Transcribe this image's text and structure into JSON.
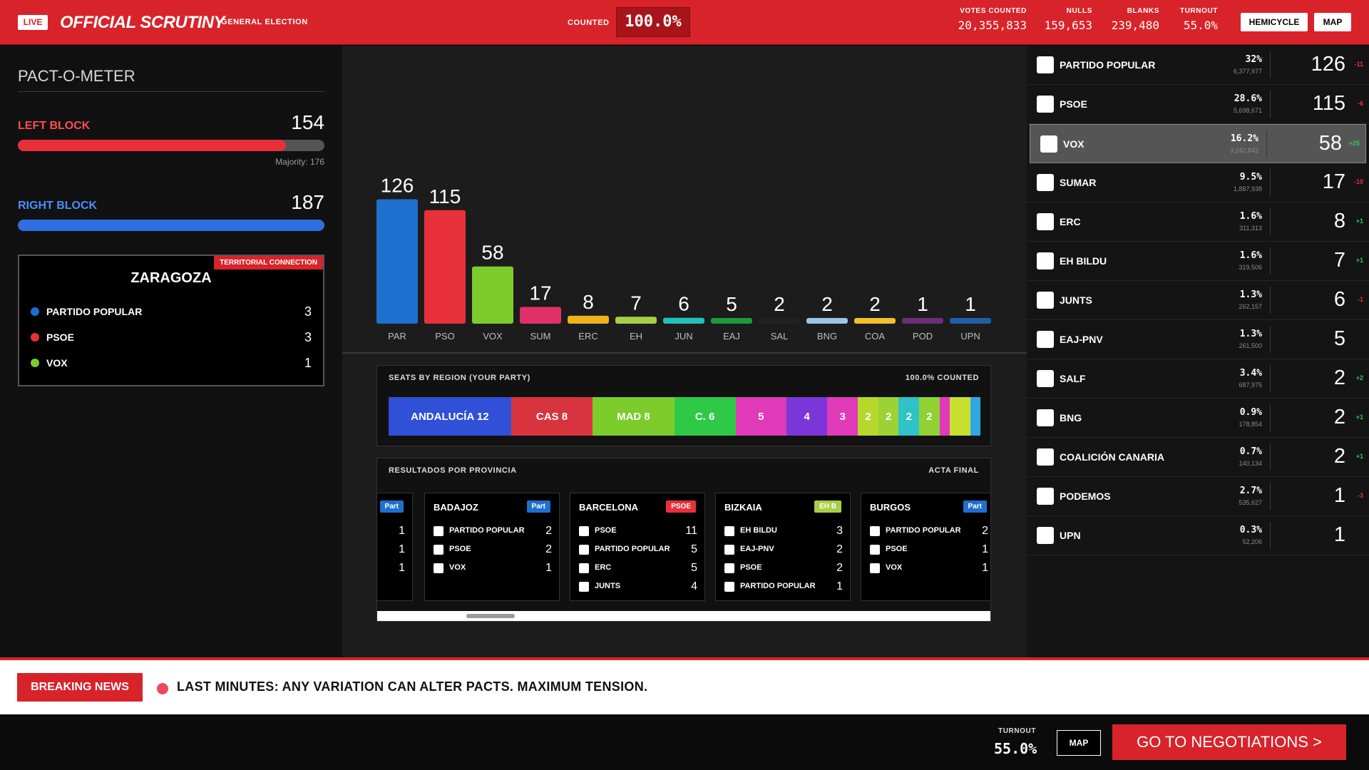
{
  "header": {
    "live": "LIVE",
    "brand": "OFFICIAL SCRUTINY",
    "subtitle": "GENERAL ELECTION",
    "counted_label": "COUNTED",
    "counted_value": "100.0%",
    "stats": [
      {
        "label": "VOTES COUNTED",
        "value": "20,355,833"
      },
      {
        "label": "NULLS",
        "value": "159,653"
      },
      {
        "label": "BLANKS",
        "value": "239,480"
      },
      {
        "label": "TURNOUT",
        "value": "55.0%"
      }
    ],
    "hemicycle_button": "HEMICYCLE",
    "map_button": "MAP"
  },
  "pact": {
    "title": "PACT-O-METER",
    "left": {
      "name": "LEFT BLOCK",
      "value": "154",
      "fill_fraction": 0.875,
      "color": "#e8303b"
    },
    "majority": "Majority: 176",
    "right": {
      "name": "RIGHT BLOCK",
      "value": "187",
      "fill_fraction": 1.0,
      "color": "#2f6ee0"
    },
    "territory": {
      "tag": "TERRITORIAL CONNECTION",
      "title": "ZARAGOZA",
      "rows": [
        {
          "name": "PARTIDO POPULAR",
          "value": "3",
          "color": "#1e6fd0"
        },
        {
          "name": "PSOE",
          "value": "3",
          "color": "#e8303b"
        },
        {
          "name": "VOX",
          "value": "1",
          "color": "#7ccc2c"
        }
      ]
    }
  },
  "chart_data": {
    "type": "bar",
    "categories": [
      "PAR",
      "PSO",
      "VOX",
      "SUM",
      "ERC",
      "EH",
      "JUN",
      "EAJ",
      "SAL",
      "BNG",
      "COA",
      "POD",
      "UPN"
    ],
    "values": [
      126,
      115,
      58,
      17,
      8,
      7,
      6,
      5,
      2,
      2,
      2,
      1,
      1
    ],
    "colors": [
      "#1f6fce",
      "#e8303b",
      "#7ccc2c",
      "#e0306a",
      "#f0b21a",
      "#a8cf45",
      "#22c0b8",
      "#1f9a3a",
      "#222222",
      "#9ec5e6",
      "#f2c02a",
      "#6b2f7a",
      "#1f5fa8"
    ],
    "ylim": [
      0,
      130
    ]
  },
  "regions": {
    "title": "SEATS BY REGION (YOUR PARTY)",
    "status": "100.0% COUNTED",
    "segments": [
      {
        "label": "ANDALUCÍA 12",
        "weight": 12,
        "color": "#3050d8"
      },
      {
        "label": "CAS 8",
        "weight": 8,
        "color": "#d8343e"
      },
      {
        "label": "MAD 8",
        "weight": 8,
        "color": "#7ccc2c"
      },
      {
        "label": "C. 6",
        "weight": 6,
        "color": "#2fc948"
      },
      {
        "label": "5",
        "weight": 5,
        "color": "#e03ab8"
      },
      {
        "label": "4",
        "weight": 4,
        "color": "#7a36d8"
      },
      {
        "label": "3",
        "weight": 3,
        "color": "#e03ab8"
      },
      {
        "label": "2",
        "weight": 2,
        "color": "#b5d82a"
      },
      {
        "label": "2",
        "weight": 2,
        "color": "#9ed234"
      },
      {
        "label": "2",
        "weight": 2,
        "color": "#2fc2c8"
      },
      {
        "label": "2",
        "weight": 2,
        "color": "#90d234"
      },
      {
        "label": "",
        "weight": 1,
        "color": "#e03ab8"
      },
      {
        "label": "",
        "weight": 2,
        "color": "#c8e030"
      },
      {
        "label": "",
        "weight": 1,
        "color": "#2fa8e0"
      }
    ]
  },
  "provinces": {
    "title": "RESULTADOS POR PROVINCIA",
    "status": "ACTA FINAL",
    "partial": {
      "tag": "Part",
      "values": [
        "1",
        "1",
        "1"
      ]
    },
    "cards": [
      {
        "name": "BADAJOZ",
        "tag": "Part",
        "tag_color": "#1f6fce",
        "rows": [
          {
            "name": "PARTIDO POPULAR",
            "value": "2"
          },
          {
            "name": "PSOE",
            "value": "2"
          },
          {
            "name": "VOX",
            "value": "1"
          }
        ]
      },
      {
        "name": "BARCELONA",
        "tag": "PSOE",
        "tag_color": "#e8303b",
        "rows": [
          {
            "name": "PSOE",
            "value": "11"
          },
          {
            "name": "PARTIDO POPULAR",
            "value": "5"
          },
          {
            "name": "ERC",
            "value": "5"
          },
          {
            "name": "JUNTS",
            "value": "4"
          }
        ]
      },
      {
        "name": "BIZKAIA",
        "tag": "EH B",
        "tag_color": "#a8cf45",
        "rows": [
          {
            "name": "EH BILDU",
            "value": "3"
          },
          {
            "name": "EAJ-PNV",
            "value": "2"
          },
          {
            "name": "PSOE",
            "value": "2"
          },
          {
            "name": "PARTIDO POPULAR",
            "value": "1"
          }
        ]
      },
      {
        "name": "BURGOS",
        "tag": "Part",
        "tag_color": "#1f6fce",
        "rows": [
          {
            "name": "PARTIDO POPULAR",
            "value": "2"
          },
          {
            "name": "PSOE",
            "value": "1"
          },
          {
            "name": "VOX",
            "value": "1"
          }
        ]
      }
    ]
  },
  "parties": [
    {
      "name": "PARTIDO POPULAR",
      "logo": "pp-logo-icon",
      "pct": "32%",
      "votes": "6,377,977",
      "seats": "126",
      "diff": "-11",
      "diff_color": "#e8303b",
      "highlight": false
    },
    {
      "name": "PSOE",
      "logo": "psoe-logo-icon",
      "pct": "28.6%",
      "votes": "5,698,671",
      "seats": "115",
      "diff": "-6",
      "diff_color": "#e8303b",
      "highlight": false
    },
    {
      "name": "VOX",
      "logo": "vox-logo-icon",
      "pct": "16.2%",
      "votes": "3,242,842",
      "seats": "58",
      "diff": "+25",
      "diff_color": "#34c759",
      "highlight": true
    },
    {
      "name": "SUMAR",
      "logo": "sumar-logo-icon",
      "pct": "9.5%",
      "votes": "1,887,938",
      "seats": "17",
      "diff": "-10",
      "diff_color": "#e8303b",
      "highlight": false
    },
    {
      "name": "ERC",
      "logo": "erc-logo-icon",
      "pct": "1.6%",
      "votes": "311,313",
      "seats": "8",
      "diff": "+1",
      "diff_color": "#34c759",
      "highlight": false
    },
    {
      "name": "EH BILDU",
      "logo": "eh-bildu-logo-icon",
      "pct": "1.6%",
      "votes": "319,506",
      "seats": "7",
      "diff": "+1",
      "diff_color": "#34c759",
      "highlight": false
    },
    {
      "name": "JUNTS",
      "logo": "junts-logo-icon",
      "pct": "1.3%",
      "votes": "262,157",
      "seats": "6",
      "diff": "-1",
      "diff_color": "#e8303b",
      "highlight": false
    },
    {
      "name": "EAJ-PNV",
      "logo": "eaj-pnv-logo-icon",
      "pct": "1.3%",
      "votes": "261,500",
      "seats": "5",
      "diff": "",
      "diff_color": "#34c759",
      "highlight": false
    },
    {
      "name": "SALF",
      "logo": "salf-logo-icon",
      "pct": "3.4%",
      "votes": "687,975",
      "seats": "2",
      "diff": "+2",
      "diff_color": "#34c759",
      "highlight": false
    },
    {
      "name": "BNG",
      "logo": "bng-logo-icon",
      "pct": "0.9%",
      "votes": "178,854",
      "seats": "2",
      "diff": "+1",
      "diff_color": "#34c759",
      "highlight": false
    },
    {
      "name": "COALICIÓN CANARIA",
      "logo": "cc-logo-icon",
      "pct": "0.7%",
      "votes": "140,134",
      "seats": "2",
      "diff": "+1",
      "diff_color": "#34c759",
      "highlight": false
    },
    {
      "name": "PODEMOS",
      "logo": "podemos-logo-icon",
      "pct": "2.7%",
      "votes": "535,627",
      "seats": "1",
      "diff": "-3",
      "diff_color": "#e8303b",
      "highlight": false
    },
    {
      "name": "UPN",
      "logo": "upn-logo-icon",
      "pct": "0.3%",
      "votes": "52,206",
      "seats": "1",
      "diff": "",
      "diff_color": "#34c759",
      "highlight": false
    }
  ],
  "news": {
    "tag": "BREAKING NEWS",
    "text": "LAST MINUTES: ANY VARIATION CAN ALTER PACTS. MAXIMUM TENSION."
  },
  "footer": {
    "turnout_label": "TURNOUT",
    "turnout_value": "55.0%",
    "map_button": "MAP",
    "go_button": "GO TO NEGOTIATIONS >"
  }
}
